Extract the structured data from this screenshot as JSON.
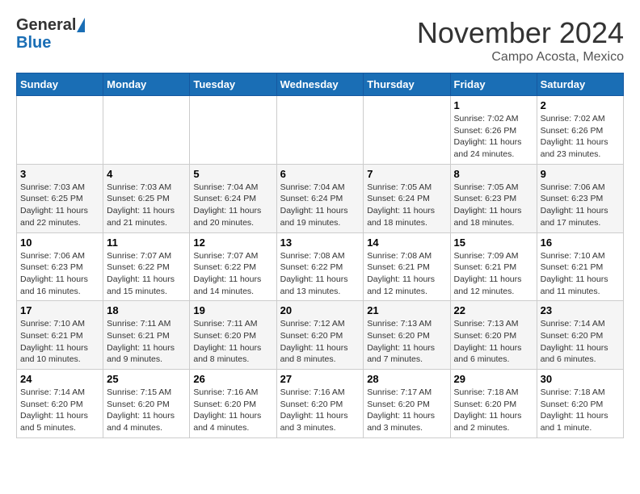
{
  "header": {
    "logo_general": "General",
    "logo_blue": "Blue",
    "month_title": "November 2024",
    "location": "Campo Acosta, Mexico"
  },
  "weekdays": [
    "Sunday",
    "Monday",
    "Tuesday",
    "Wednesday",
    "Thursday",
    "Friday",
    "Saturday"
  ],
  "weeks": [
    [
      {
        "day": "",
        "info": ""
      },
      {
        "day": "",
        "info": ""
      },
      {
        "day": "",
        "info": ""
      },
      {
        "day": "",
        "info": ""
      },
      {
        "day": "",
        "info": ""
      },
      {
        "day": "1",
        "info": "Sunrise: 7:02 AM\nSunset: 6:26 PM\nDaylight: 11 hours and 24 minutes."
      },
      {
        "day": "2",
        "info": "Sunrise: 7:02 AM\nSunset: 6:26 PM\nDaylight: 11 hours and 23 minutes."
      }
    ],
    [
      {
        "day": "3",
        "info": "Sunrise: 7:03 AM\nSunset: 6:25 PM\nDaylight: 11 hours and 22 minutes."
      },
      {
        "day": "4",
        "info": "Sunrise: 7:03 AM\nSunset: 6:25 PM\nDaylight: 11 hours and 21 minutes."
      },
      {
        "day": "5",
        "info": "Sunrise: 7:04 AM\nSunset: 6:24 PM\nDaylight: 11 hours and 20 minutes."
      },
      {
        "day": "6",
        "info": "Sunrise: 7:04 AM\nSunset: 6:24 PM\nDaylight: 11 hours and 19 minutes."
      },
      {
        "day": "7",
        "info": "Sunrise: 7:05 AM\nSunset: 6:24 PM\nDaylight: 11 hours and 18 minutes."
      },
      {
        "day": "8",
        "info": "Sunrise: 7:05 AM\nSunset: 6:23 PM\nDaylight: 11 hours and 18 minutes."
      },
      {
        "day": "9",
        "info": "Sunrise: 7:06 AM\nSunset: 6:23 PM\nDaylight: 11 hours and 17 minutes."
      }
    ],
    [
      {
        "day": "10",
        "info": "Sunrise: 7:06 AM\nSunset: 6:23 PM\nDaylight: 11 hours and 16 minutes."
      },
      {
        "day": "11",
        "info": "Sunrise: 7:07 AM\nSunset: 6:22 PM\nDaylight: 11 hours and 15 minutes."
      },
      {
        "day": "12",
        "info": "Sunrise: 7:07 AM\nSunset: 6:22 PM\nDaylight: 11 hours and 14 minutes."
      },
      {
        "day": "13",
        "info": "Sunrise: 7:08 AM\nSunset: 6:22 PM\nDaylight: 11 hours and 13 minutes."
      },
      {
        "day": "14",
        "info": "Sunrise: 7:08 AM\nSunset: 6:21 PM\nDaylight: 11 hours and 12 minutes."
      },
      {
        "day": "15",
        "info": "Sunrise: 7:09 AM\nSunset: 6:21 PM\nDaylight: 11 hours and 12 minutes."
      },
      {
        "day": "16",
        "info": "Sunrise: 7:10 AM\nSunset: 6:21 PM\nDaylight: 11 hours and 11 minutes."
      }
    ],
    [
      {
        "day": "17",
        "info": "Sunrise: 7:10 AM\nSunset: 6:21 PM\nDaylight: 11 hours and 10 minutes."
      },
      {
        "day": "18",
        "info": "Sunrise: 7:11 AM\nSunset: 6:21 PM\nDaylight: 11 hours and 9 minutes."
      },
      {
        "day": "19",
        "info": "Sunrise: 7:11 AM\nSunset: 6:20 PM\nDaylight: 11 hours and 8 minutes."
      },
      {
        "day": "20",
        "info": "Sunrise: 7:12 AM\nSunset: 6:20 PM\nDaylight: 11 hours and 8 minutes."
      },
      {
        "day": "21",
        "info": "Sunrise: 7:13 AM\nSunset: 6:20 PM\nDaylight: 11 hours and 7 minutes."
      },
      {
        "day": "22",
        "info": "Sunrise: 7:13 AM\nSunset: 6:20 PM\nDaylight: 11 hours and 6 minutes."
      },
      {
        "day": "23",
        "info": "Sunrise: 7:14 AM\nSunset: 6:20 PM\nDaylight: 11 hours and 6 minutes."
      }
    ],
    [
      {
        "day": "24",
        "info": "Sunrise: 7:14 AM\nSunset: 6:20 PM\nDaylight: 11 hours and 5 minutes."
      },
      {
        "day": "25",
        "info": "Sunrise: 7:15 AM\nSunset: 6:20 PM\nDaylight: 11 hours and 4 minutes."
      },
      {
        "day": "26",
        "info": "Sunrise: 7:16 AM\nSunset: 6:20 PM\nDaylight: 11 hours and 4 minutes."
      },
      {
        "day": "27",
        "info": "Sunrise: 7:16 AM\nSunset: 6:20 PM\nDaylight: 11 hours and 3 minutes."
      },
      {
        "day": "28",
        "info": "Sunrise: 7:17 AM\nSunset: 6:20 PM\nDaylight: 11 hours and 3 minutes."
      },
      {
        "day": "29",
        "info": "Sunrise: 7:18 AM\nSunset: 6:20 PM\nDaylight: 11 hours and 2 minutes."
      },
      {
        "day": "30",
        "info": "Sunrise: 7:18 AM\nSunset: 6:20 PM\nDaylight: 11 hours and 1 minute."
      }
    ]
  ]
}
